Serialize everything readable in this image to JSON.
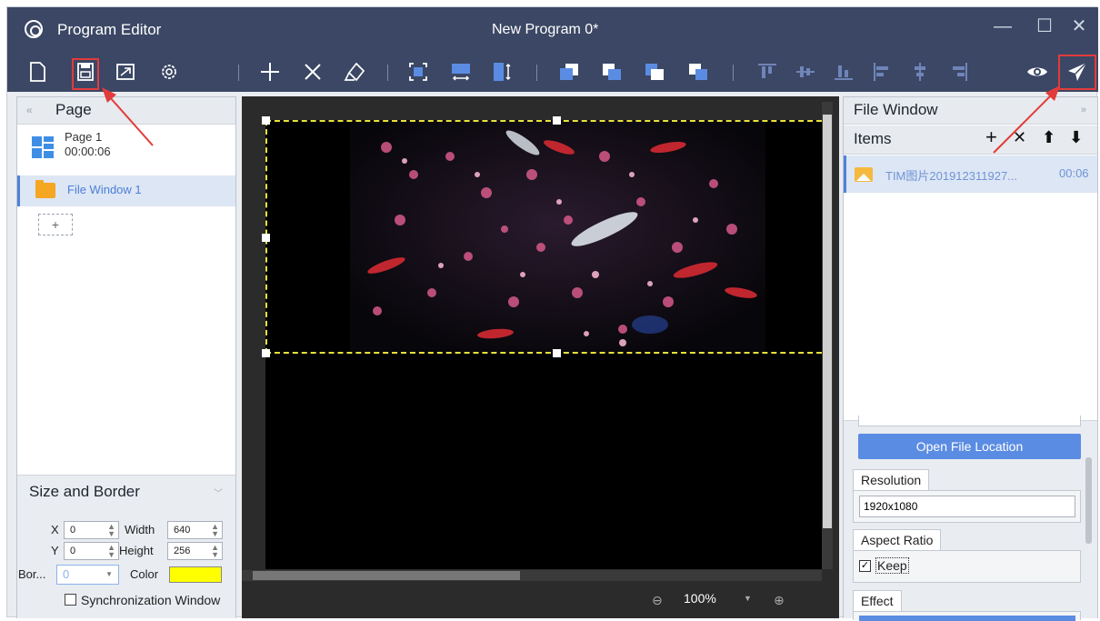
{
  "window": {
    "app_name": "Program Editor",
    "doc_title": "New Program 0*",
    "minimize": "—",
    "maximize": "☐",
    "close": "✕"
  },
  "toolbar": {
    "icons": [
      "new-file-icon",
      "save-icon",
      "fullscreen-icon",
      "settings-icon",
      "add-icon",
      "delete-icon",
      "clear-icon",
      "fit-icon",
      "stretch-horizontal-icon",
      "stretch-vertical-icon",
      "layer-front-icon",
      "layer-forward-icon",
      "layer-backward-icon",
      "layer-back-icon",
      "align-top-icon",
      "align-middle-icon",
      "align-bottom-icon",
      "align-left-icon",
      "align-center-icon",
      "align-right-icon",
      "preview-icon",
      "send-icon"
    ]
  },
  "left_pane": {
    "collapse_glyph": "«",
    "title": "Page",
    "page": {
      "name": "Page 1",
      "duration": "00:00:06"
    },
    "file_window": "File Window 1",
    "add_glyph": "+"
  },
  "size_border": {
    "title": "Size and Border",
    "x_label": "X",
    "x_value": "0",
    "width_label": "Width",
    "width_value": "640",
    "y_label": "Y",
    "y_value": "0",
    "height_label": "Height",
    "height_value": "256",
    "border_label": "Bor...",
    "border_value": "0",
    "color_label": "Color",
    "color_value": "#ffff00",
    "sync_label": "Synchronization Window"
  },
  "canvas": {
    "zoom": "100%",
    "selection_color": "#e8e23a"
  },
  "right_pane": {
    "title": "File Window",
    "expand_glyph": "»",
    "items_title": "Items",
    "item": {
      "name": "TIM图片201912311927...",
      "duration": "00:06"
    },
    "open_location": "Open File Location",
    "resolution_label": "Resolution",
    "resolution_value": "1920x1080",
    "aspect_label": "Aspect Ratio",
    "keep_label": "Keep",
    "effect_label": "Effect"
  },
  "colors": {
    "titlebar": "#3b4764",
    "accent": "#5b8ce3",
    "annotation": "#e23b3b"
  }
}
